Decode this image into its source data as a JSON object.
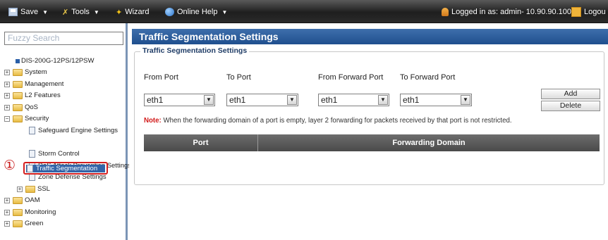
{
  "toolbar": {
    "save_label": "Save",
    "tools_label": "Tools",
    "wizard_label": "Wizard",
    "online_help_label": "Online Help",
    "login_text": "Logged in as: admin- 10.90.90.100",
    "logout_label": "Logou"
  },
  "sidebar": {
    "search_placeholder": "Fuzzy Search",
    "device": "DIS-200G-12PS/12PSW",
    "nodes": {
      "system": "System",
      "management": "Management",
      "l2_features": "L2 Features",
      "qos": "QoS",
      "security": "Security",
      "safeguard": "Safeguard Engine Settings",
      "traffic_segmentation": "Traffic Segmentation",
      "storm_control": "Storm Control",
      "dos": "DoS Attack Prevention Settings",
      "zone_defense": "Zone Defense Settings",
      "ssl": "SSL",
      "oam": "OAM",
      "monitoring": "Monitoring",
      "green": "Green"
    },
    "annotation_marker": "①"
  },
  "main": {
    "title": "Traffic Segmentation Settings",
    "section_legend": "Traffic Segmentation Settings",
    "from_port_label": "From Port",
    "to_port_label": "To Port",
    "from_forward_port_label": "From Forward Port",
    "to_forward_port_label": "To Forward Port",
    "from_port_value": "eth1",
    "to_port_value": "eth1",
    "from_forward_port_value": "eth1",
    "to_forward_port_value": "eth1",
    "add_label": "Add",
    "delete_label": "Delete",
    "note_label": "Note:",
    "note_text": " When the forwarding domain of a port is empty, layer 2 forwarding for packets received by that port is not restricted.",
    "table_headers": [
      "Port",
      "Forwarding Domain"
    ]
  },
  "colors": {
    "title_bar": "#2a5a98",
    "selected_item": "#3264a8",
    "annotation_red": "#d41e1e",
    "table_header": "#5a5a5a",
    "note_red": "#d21a1a"
  }
}
